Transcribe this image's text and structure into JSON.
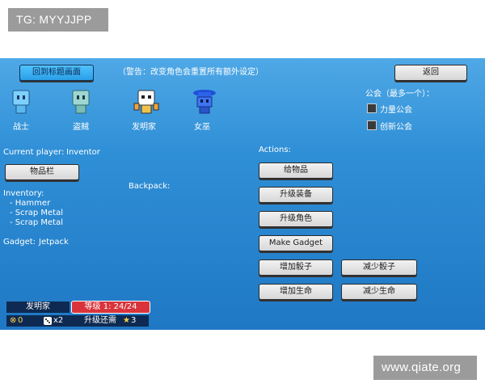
{
  "watermarks": {
    "top_left": "TG: MYYJJPP",
    "bottom_right": "www.qiate.org"
  },
  "header": {
    "title_button": "回到标题画面",
    "warning": "（警告：改变角色会重置所有额外设定）",
    "back_button": "返回"
  },
  "characters": [
    {
      "name": "战士",
      "icon": "warrior-robot-icon"
    },
    {
      "name": "盗贼",
      "icon": "rogue-robot-icon"
    },
    {
      "name": "发明家",
      "icon": "inventor-robot-icon"
    },
    {
      "name": "女巫",
      "icon": "witch-robot-icon"
    }
  ],
  "guild": {
    "title": "公会（最多一个）：",
    "options": [
      {
        "label": "力量公会",
        "checked": false
      },
      {
        "label": "创新公会",
        "checked": false
      }
    ]
  },
  "player": {
    "current_label": "Current player:",
    "current_value": "Inventor",
    "inventory_button": "物品栏",
    "inventory_title": "Inventory:",
    "inventory_items": [
      "- Hammer",
      "- Scrap Metal",
      "- Scrap Metal"
    ],
    "gadget_label": "Gadget:",
    "gadget_value": "Jetpack",
    "backpack_label": "Backpack:"
  },
  "actions": {
    "title": "Actions:",
    "give_item": "给物品",
    "upgrade_equipment": "升级装备",
    "upgrade_character": "升级角色",
    "make_gadget": "Make Gadget",
    "add_dice": "增加骰子",
    "remove_dice": "减少骰子",
    "add_health": "增加生命",
    "remove_health": "减少生命"
  },
  "status": {
    "class_name": "发明家",
    "level_text": "等级 1: 24/24",
    "coins": "0",
    "dice_count": "x2",
    "upgrade_label": "升级还需",
    "upgrade_value": "3"
  },
  "colors": {
    "background_top": "#4fa8e6",
    "background_bottom": "#1f78c4",
    "level_badge": "#d9343b",
    "status_bar": "#0e2a52"
  }
}
